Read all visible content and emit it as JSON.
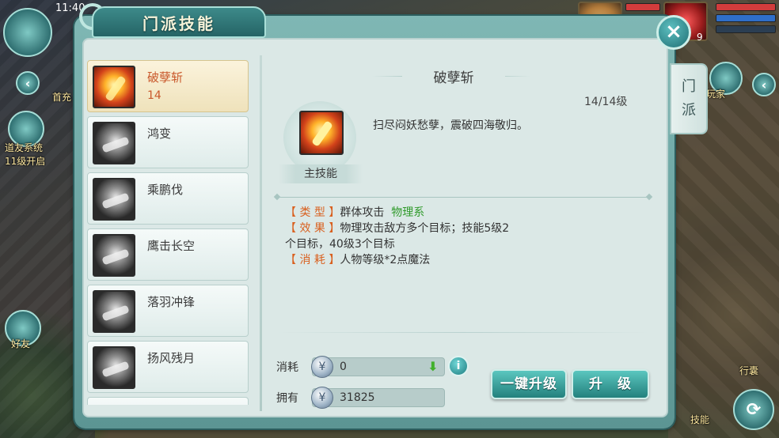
{
  "hud": {
    "time": "11:40",
    "left_labels": {
      "first_charge": "首充",
      "friend_system": "道友系统",
      "friend_unlock": "11级开启",
      "friends": "好友"
    },
    "right_labels": {
      "hidden_players": "屏蔽玩家",
      "bag": "行囊",
      "skills": "技能"
    },
    "player_level": "9"
  },
  "dialog": {
    "title": "门派技能",
    "side_tab": [
      "门",
      "派"
    ],
    "close_symbol": "×"
  },
  "skills": [
    {
      "name": "破孽斩",
      "level": "14",
      "active": true
    },
    {
      "name": "鸿变",
      "level": ""
    },
    {
      "name": "乘鹏伐",
      "level": ""
    },
    {
      "name": "鹰击长空",
      "level": ""
    },
    {
      "name": "落羽冲锋",
      "level": ""
    },
    {
      "name": "扬风残月",
      "level": ""
    }
  ],
  "detail": {
    "name": "破孽斩",
    "level": "14/14级",
    "main_label": "主技能",
    "description": "扫尽闷妖愁孽，震破四海敬归。",
    "type_key": "【 类 型 】",
    "type_value": "群体攻击",
    "type_school": "物理系",
    "effect_key": "【 效 果 】",
    "effect_value_1": "物理攻击敌方多个目标；技能5级2",
    "effect_value_2": "个目标，40级3个目标",
    "cost_key": "【 消 耗 】",
    "cost_value": "人物等级*2点魔法"
  },
  "upgrade": {
    "cost_label": "消耗",
    "cost_value": "0",
    "owned_label": "拥有",
    "owned_value": "31825",
    "one_key_button": "一键升级",
    "upgrade_button": "升　级",
    "coin_symbol": "¥",
    "arrow_symbol": "⬇",
    "info_symbol": "i"
  }
}
